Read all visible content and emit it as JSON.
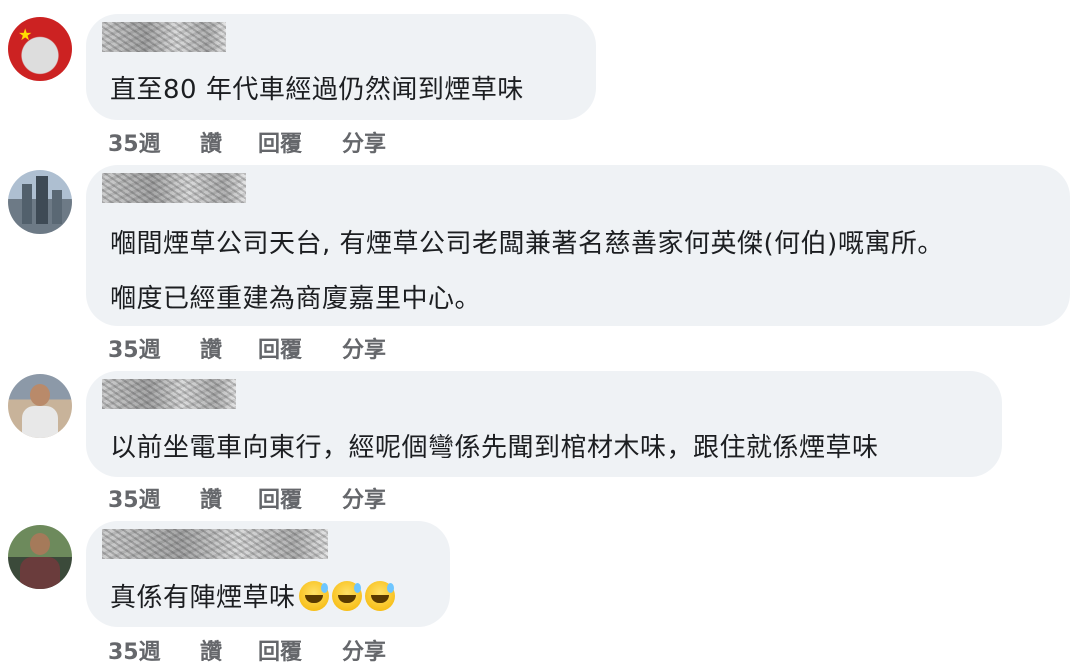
{
  "comments": [
    {
      "avatar_icon": "profile-avatar-flag",
      "lines": [
        "直至80 年代車經過仍然闻到煙草味"
      ],
      "time": "35週",
      "like": "讚",
      "reply": "回覆",
      "share": "分享"
    },
    {
      "avatar_icon": "profile-avatar-city",
      "lines": [
        "嗰間煙草公司天台, 有煙草公司老闆兼著名慈善家何英傑(何伯)嘅寓所。",
        "嗰度已經重建為商廈嘉里中心。"
      ],
      "time": "35週",
      "like": "讚",
      "reply": "回覆",
      "share": "分享"
    },
    {
      "avatar_icon": "profile-avatar-person",
      "lines": [
        "以前坐電車向東行，經呢個彎係先聞到棺材木味，跟住就係煙草味"
      ],
      "time": "35週",
      "like": "讚",
      "reply": "回覆",
      "share": "分享"
    },
    {
      "avatar_icon": "profile-avatar-person-2",
      "lines": [
        "真係有陣煙草味"
      ],
      "emoji_icon": "grinning-sweat-emoji",
      "time": "35週",
      "like": "讚",
      "reply": "回覆",
      "share": "分享"
    }
  ]
}
